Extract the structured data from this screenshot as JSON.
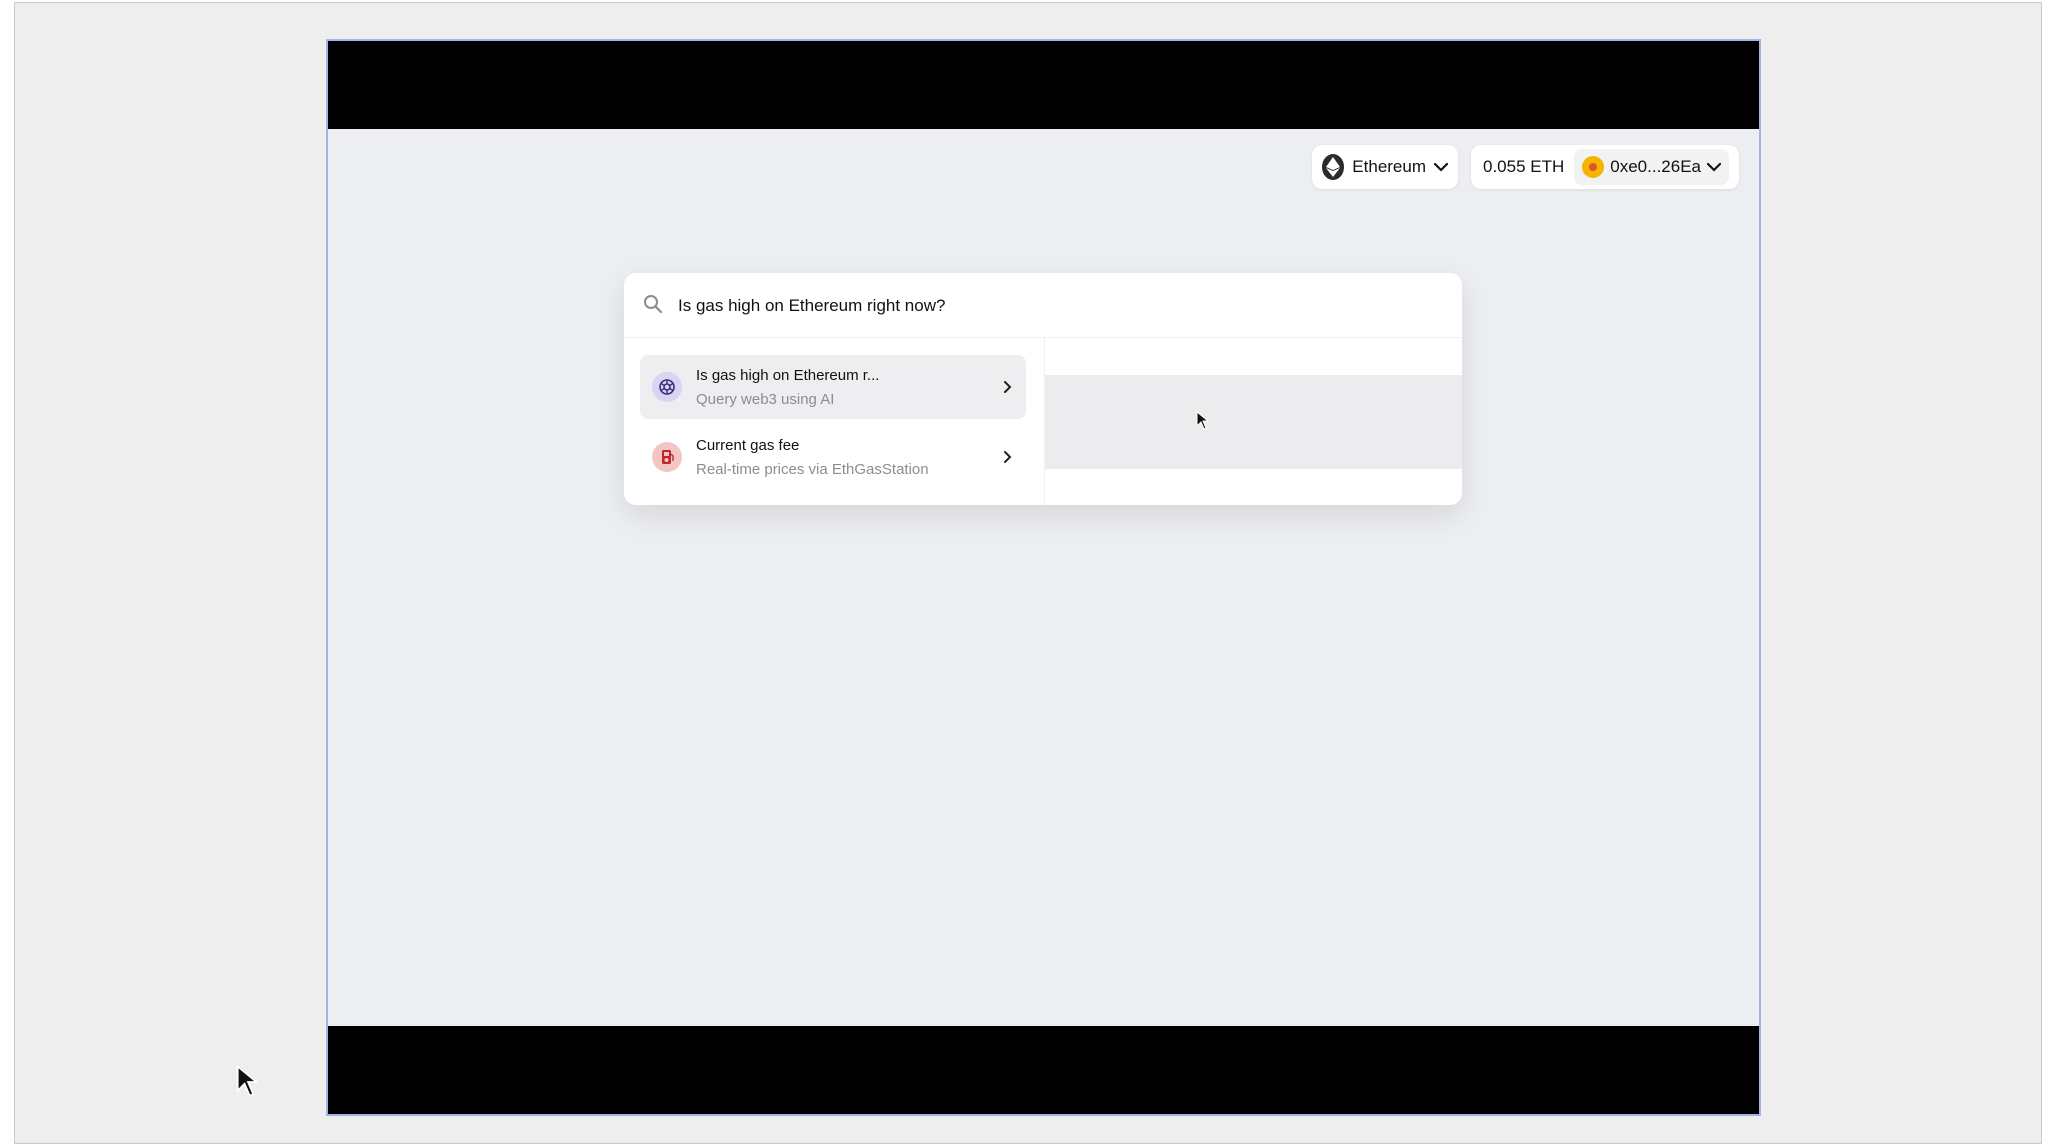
{
  "network": {
    "label": "Ethereum",
    "icon": "ethereum-icon"
  },
  "wallet": {
    "balance": "0.055 ETH",
    "address": "0xe0...26Ea",
    "avatar_icon": "coin-avatar-icon"
  },
  "search": {
    "query": "Is gas high on Ethereum right now?",
    "icon": "search-icon"
  },
  "results": [
    {
      "title": "Is gas high on Ethereum r...",
      "subtitle": "Query web3 using AI",
      "icon": "openai-icon",
      "active": true
    },
    {
      "title": "Current gas fee",
      "subtitle": "Real-time prices via EthGasStation",
      "icon": "gas-pump-icon",
      "active": false
    }
  ],
  "colors": {
    "accent_ai": "#d9d3f4",
    "accent_gas": "#f3c6c6",
    "background": "#eceef2"
  }
}
